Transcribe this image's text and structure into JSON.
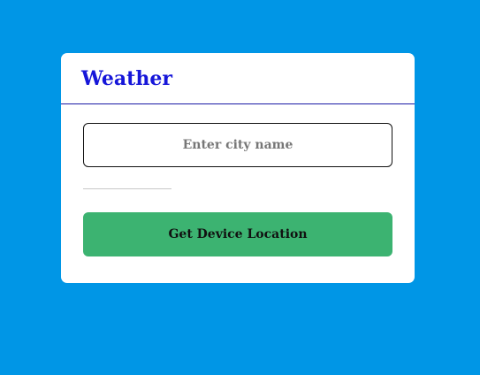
{
  "app": {
    "title": "Weather"
  },
  "search": {
    "value": "",
    "placeholder": "Enter city name"
  },
  "location_button": {
    "label": "Get Device Location"
  },
  "colors": {
    "page_background": "#0096e6",
    "card_background": "#ffffff",
    "title_text": "#1616d9",
    "header_divider": "#1a1aa6",
    "button_background": "#3cb371"
  }
}
